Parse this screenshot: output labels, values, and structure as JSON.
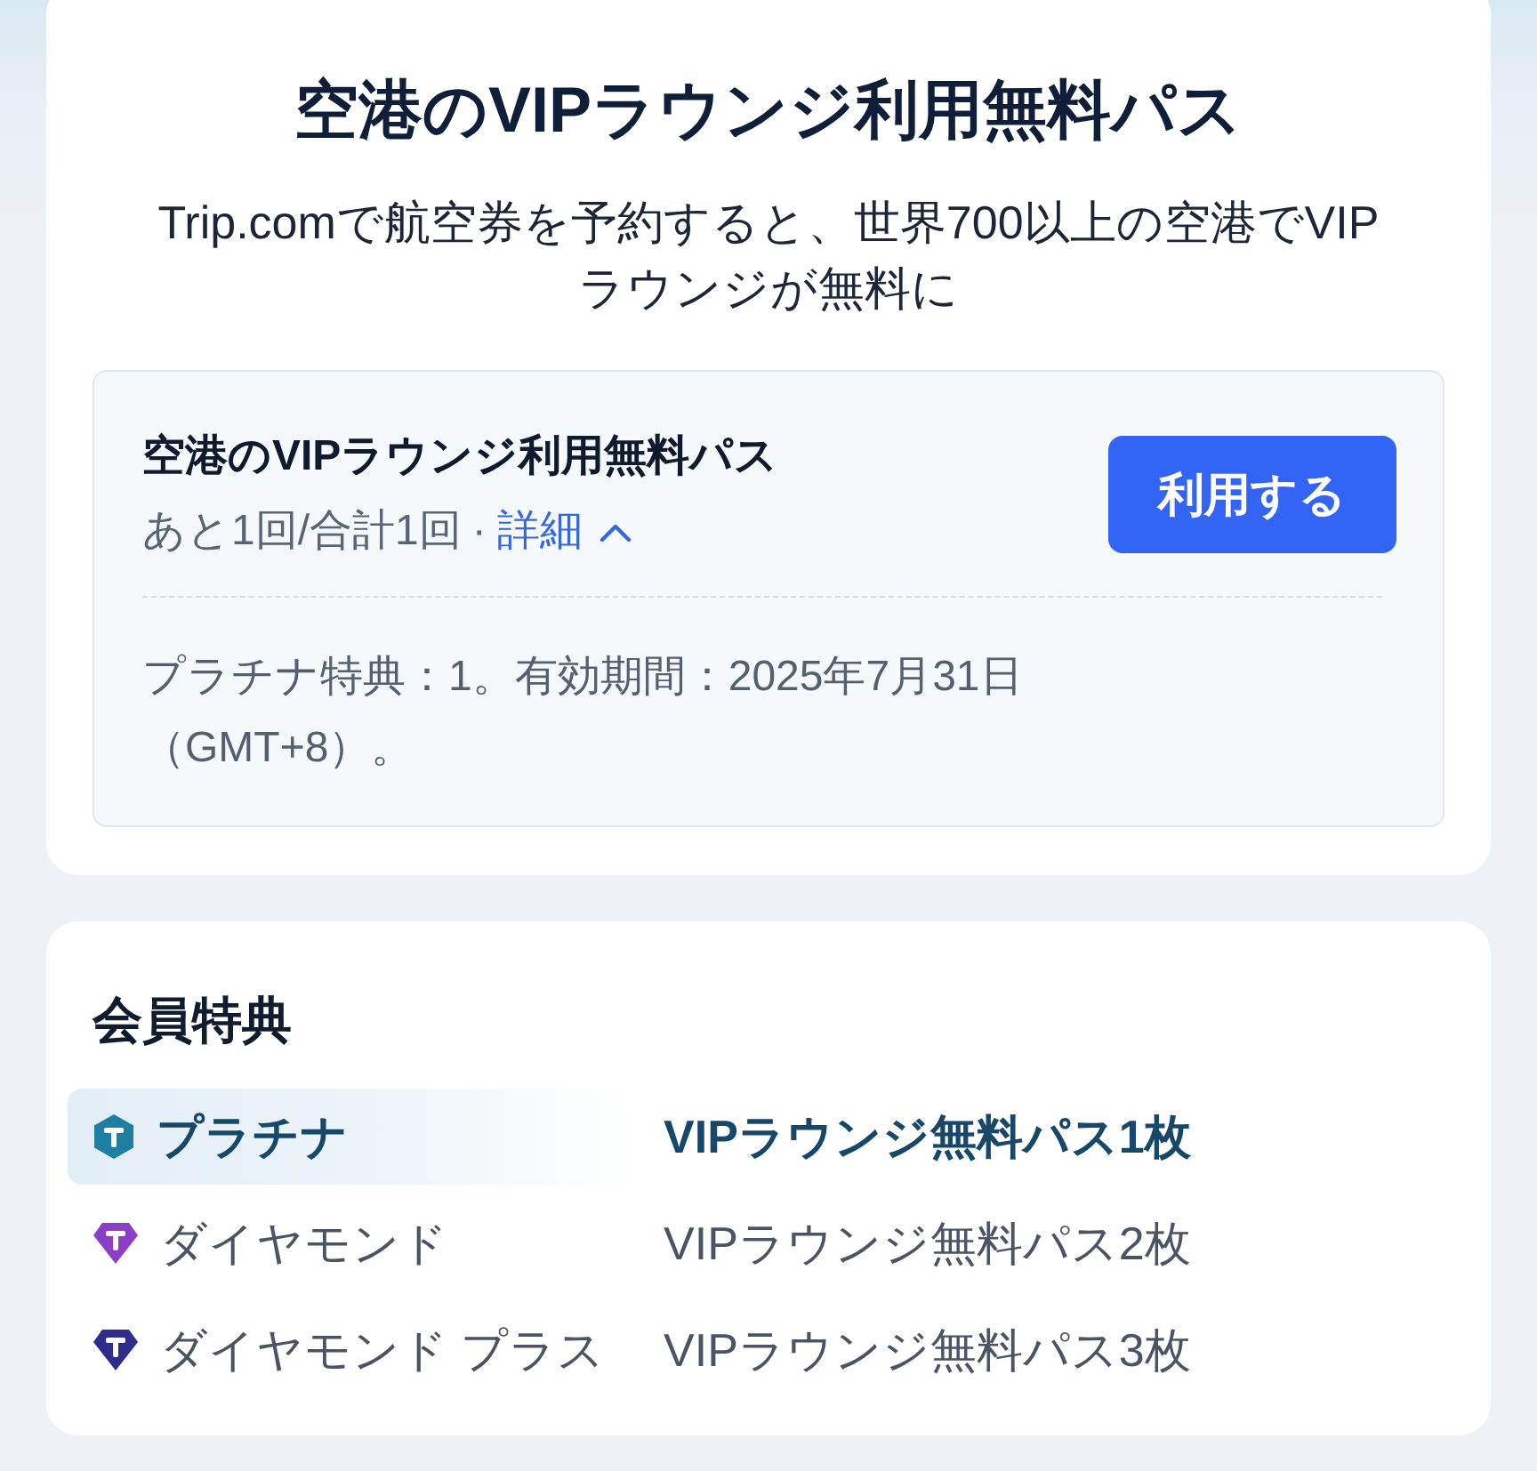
{
  "header": {
    "title": "空港のVIPラウンジ利用無料パス",
    "subtitle": "Trip.comで航空券を予約すると、世界700以上の空港でVIPラウンジが無料に"
  },
  "pass_card": {
    "title": "空港のVIPラウンジ利用無料パス",
    "usage": "あと1回/合計1回",
    "separator": "·",
    "details_link": "詳細",
    "expanded": true,
    "use_button": "利用する",
    "description": "プラチナ特典：1。有効期間：2025年7月31日（GMT+8）。"
  },
  "benefits": {
    "title": "会員特典",
    "tiers": [
      {
        "kind": "hexagon",
        "color": "#1e7fa3",
        "name": "プラチナ",
        "benefit": "VIPラウンジ無料パス1枚",
        "selected": true
      },
      {
        "kind": "gem",
        "color": "#8b3fc6",
        "name": "ダイヤモンド",
        "benefit": "VIPラウンジ無料パス2枚",
        "selected": false
      },
      {
        "kind": "gem",
        "color": "#2e2c8c",
        "name": "ダイヤモンド プラス",
        "benefit": "VIPラウンジ無料パス3枚",
        "selected": false
      }
    ]
  }
}
